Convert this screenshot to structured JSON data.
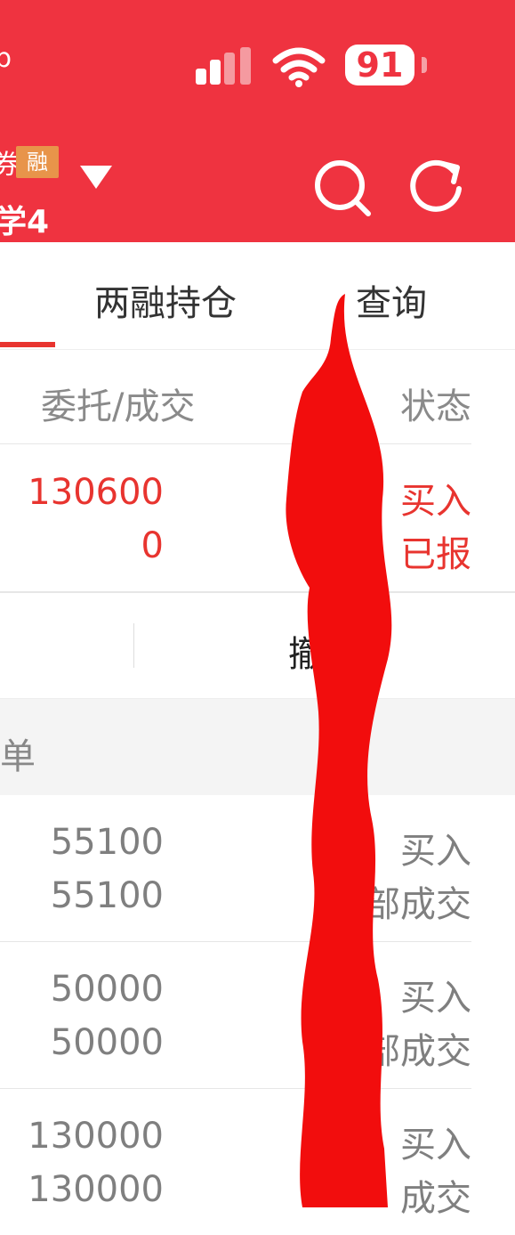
{
  "status_bar": {
    "left_text": "p",
    "battery": "91"
  },
  "account": {
    "prefix_char": "券",
    "badge": "融",
    "name": "学4"
  },
  "tabs": [
    {
      "label": "两融持仓"
    },
    {
      "label": "查询"
    }
  ],
  "columns": {
    "order_trade": "委托/成交",
    "status": "状态"
  },
  "pending_order": {
    "order_qty": "130600",
    "trade_qty": "0",
    "direction": "买入",
    "status": "已报"
  },
  "actions": {
    "cancel": "撤"
  },
  "section": {
    "title": "单"
  },
  "trades": [
    {
      "order_qty": "55100",
      "trade_qty": "55100",
      "direction": "买入",
      "status": "全部成交"
    },
    {
      "order_qty": "50000",
      "trade_qty": "50000",
      "direction": "买入",
      "status": "全部成交"
    },
    {
      "order_qty": "130000",
      "trade_qty": "130000",
      "direction": "买入",
      "status": "成交"
    }
  ],
  "colors": {
    "header_bg": "#ef3340",
    "accent_red": "#e8342f",
    "badge_orange": "#e8944a"
  }
}
